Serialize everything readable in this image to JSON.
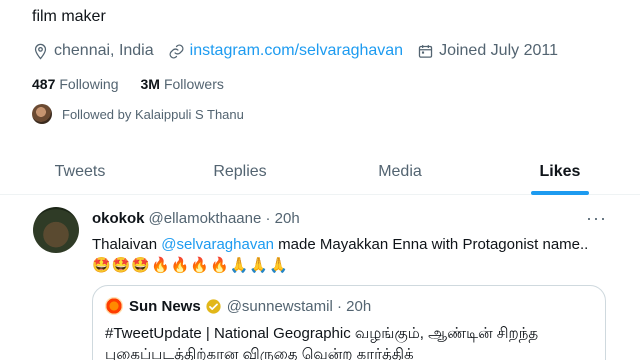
{
  "profile": {
    "bio": "film maker",
    "location": "chennai,  India",
    "website": "instagram.com/selvaraghavan",
    "joined": "Joined July 2011",
    "following_count": "487",
    "following_label": "Following",
    "followers_count": "3M",
    "followers_label": "Followers",
    "followed_by": "Followed by Kalaippuli S Thanu"
  },
  "tabs": [
    {
      "label": "Tweets"
    },
    {
      "label": "Replies"
    },
    {
      "label": "Media"
    },
    {
      "label": "Likes",
      "active": true
    }
  ],
  "tweet": {
    "author_name": "okokok",
    "author_handle": "@ellamokthaane",
    "time": "· 20h",
    "text_before": "Thalaivan ",
    "mention": "@selvaraghavan",
    "text_after": " made Mayakkan Enna with Protagonist name..",
    "emojis": "🤩🤩🤩🔥🔥🔥🔥🙏🙏🙏",
    "more_label": "···",
    "quote": {
      "author_name": "Sun News",
      "author_handle": "@sunnewstamil",
      "time": "· 20h",
      "line1": "#TweetUpdate | National Geographic வழங்கும், ஆண்டின் சிறந்த",
      "line2": "புகைப்படத்திற்கான விருதை வென்ற கார்த்திக்"
    }
  },
  "colors": {
    "accent": "#1d9bf0",
    "text_primary": "#0f1419",
    "text_secondary": "#536471",
    "border": "#cfd9de"
  }
}
